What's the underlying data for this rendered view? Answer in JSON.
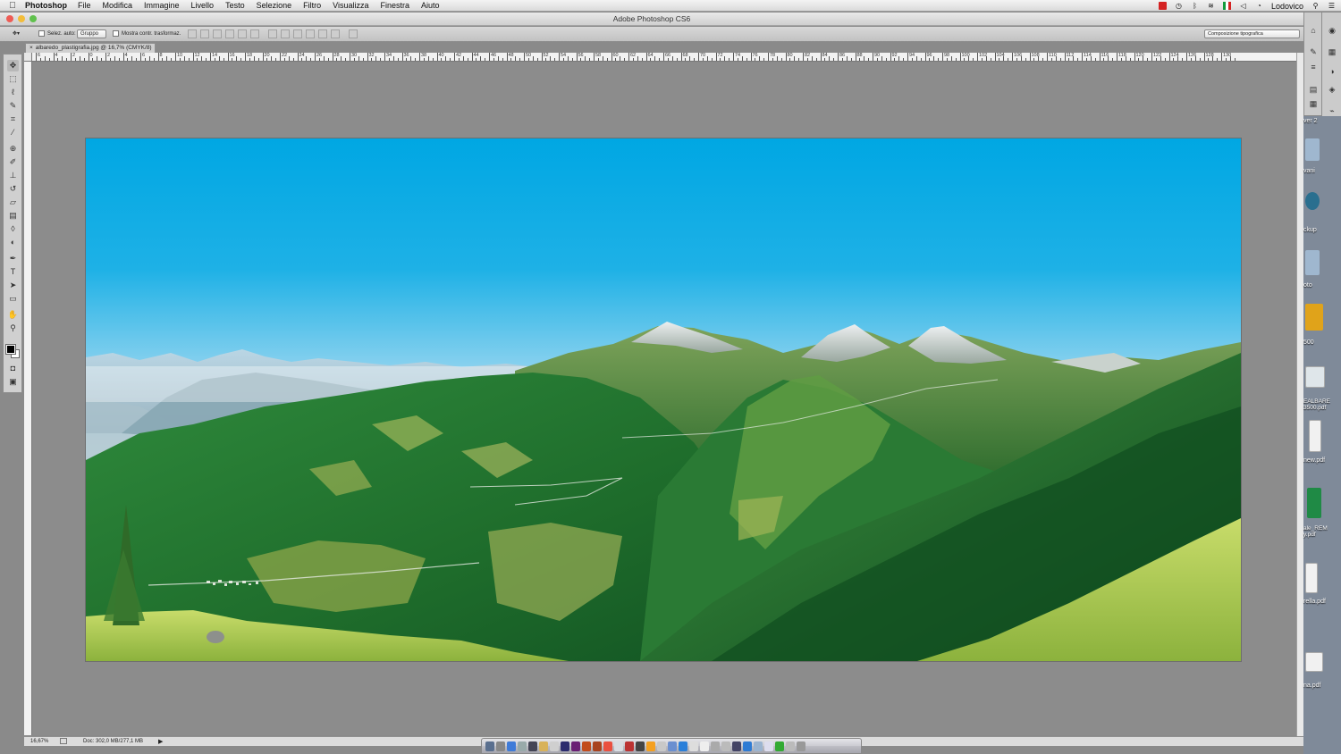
{
  "menubar": {
    "app": "Photoshop",
    "items": [
      "File",
      "Modifica",
      "Immagine",
      "Livello",
      "Testo",
      "Selezione",
      "Filtro",
      "Visualizza",
      "Finestra",
      "Aiuto"
    ],
    "user": "Lodovico"
  },
  "window": {
    "title": "Adobe Photoshop CS6"
  },
  "options": {
    "auto_select_label": "Selez. auto:",
    "auto_select_value": "Gruppo",
    "transform_label": "Mostra contr. trasformaz.",
    "workspace": "Composizione tipografica"
  },
  "document": {
    "tab_label": "albaredo_plastigrafia.jpg @ 16,7% (CMYK/8)",
    "zoom": "16,67%",
    "doc_info": "Doc: 302,0 MB/277,1 MB"
  },
  "ruler": {
    "labels": [
      "6",
      "4",
      "2",
      "0",
      "2",
      "4",
      "6",
      "8",
      "10",
      "12",
      "14",
      "16",
      "18",
      "20",
      "22",
      "24",
      "26",
      "28",
      "30",
      "32",
      "34",
      "36",
      "38",
      "40",
      "42",
      "44",
      "46",
      "48",
      "50",
      "52",
      "54",
      "56",
      "58",
      "60",
      "62",
      "64",
      "66",
      "68",
      "70",
      "72",
      "74",
      "76",
      "78",
      "80",
      "82",
      "84",
      "86",
      "88",
      "90",
      "92",
      "94",
      "96",
      "98",
      "100",
      "102",
      "104",
      "106",
      "108",
      "110",
      "112",
      "114",
      "116",
      "118",
      "120",
      "122",
      "124",
      "126",
      "128",
      "130"
    ]
  },
  "desktop": {
    "labels": [
      "ver 2",
      "vani",
      "ckup",
      "oto",
      "500",
      "EALBARE 3500.pdf",
      "new.pdf",
      "ale_REM y.pdf",
      "rella.pdf",
      "na.pdf"
    ]
  },
  "colors": {
    "sky_top": "#00a7e3",
    "menubar": "#e6e6e6",
    "workspace": "#8c8c8c"
  },
  "icons": [
    "apple-icon",
    "move-tool-icon",
    "marquee-tool-icon",
    "lasso-tool-icon",
    "quick-select-icon",
    "crop-tool-icon",
    "eyedropper-icon",
    "healing-brush-icon",
    "brush-tool-icon",
    "stamp-tool-icon",
    "history-brush-icon",
    "eraser-icon",
    "gradient-icon",
    "blur-icon",
    "dodge-icon",
    "pen-tool-icon",
    "type-tool-icon",
    "path-select-icon",
    "shape-tool-icon",
    "hand-tool-icon",
    "zoom-tool-icon"
  ]
}
